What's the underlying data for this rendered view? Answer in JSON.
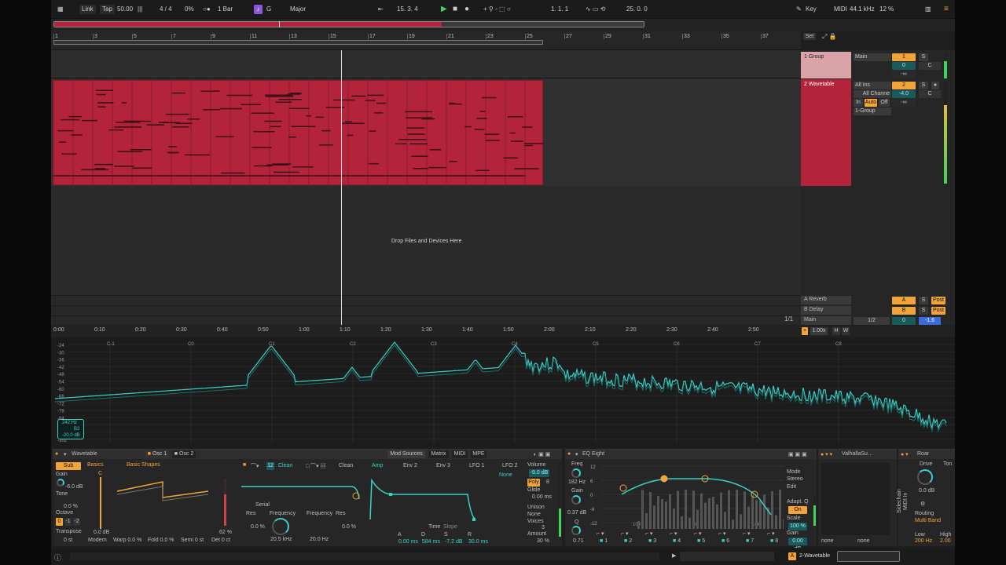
{
  "toolbar": {
    "link": "Link",
    "tap": "Tap",
    "tempo": "50.00",
    "signature": "4 / 4",
    "swing": "0%",
    "quantize": "1 Bar",
    "key": "G",
    "scale": "Major",
    "position": "15.   3.   4",
    "loop_start": "1.   1.   1",
    "loop_length": "25.   0.   0",
    "key_btn": "Key",
    "midi_btn": "MIDI",
    "sample_rate": "44.1 kHz",
    "cpu": "12 %"
  },
  "ruler": {
    "bars": [
      "1",
      "3",
      "5",
      "7",
      "9",
      "11",
      "13",
      "15",
      "17",
      "19",
      "21",
      "23",
      "25",
      "27",
      "29",
      "31",
      "33",
      "35",
      "37"
    ],
    "set_btn": "Set"
  },
  "arrangement": {
    "drop_text": "Drop Files and Devices Here",
    "fraction": "1/1"
  },
  "mixer": {
    "group_track": "1 Group",
    "group_out": "Main",
    "group_num": "1",
    "group_vol": "0",
    "group_pan": "C",
    "wt_track": "2 Wavetable",
    "wt_in": "All Ins",
    "wt_ch": "All Channe",
    "wt_out": "1-Group",
    "wt_num": "2",
    "wt_vol": "-4.0",
    "wt_pan": "C",
    "mon_in": "In",
    "mon_auto": "Auto",
    "mon_off": "Off",
    "inf": "-∞",
    "return_a": "A Reverb",
    "return_b": "B Delay",
    "master": "Main",
    "master_out": "1/2",
    "master_vol": "0",
    "master_db": "-1.6",
    "solo": "S",
    "post": "Post",
    "ret_a": "A",
    "ret_b": "B",
    "zoom": "1.00x",
    "h": "H",
    "w": "W"
  },
  "timeline": {
    "labels": [
      "0:00",
      "0:10",
      "0:20",
      "0:30",
      "0:40",
      "0:50",
      "1:00",
      "1:10",
      "1:20",
      "1:30",
      "1:40",
      "1:50",
      "2:00",
      "2:10",
      "2:20",
      "2:30",
      "2:40",
      "2:50"
    ]
  },
  "spectrum": {
    "db_labels": [
      "-24",
      "-30",
      "-36",
      "-42",
      "-48",
      "-54",
      "-60",
      "-66",
      "-72",
      "-78",
      "-84",
      "-90",
      "-96",
      "-102"
    ],
    "notes": [
      "C-1",
      "C0",
      "C1",
      "C2",
      "C3",
      "C4",
      "C5",
      "C6",
      "C7",
      "C8"
    ],
    "readout_freq": "242 Hz",
    "readout_note": "B2",
    "readout_db": "-20.0 dB"
  },
  "wavetable": {
    "title": "Wavetable",
    "osc1": "Osc 1",
    "osc2": "Osc 2",
    "sub": "Sub",
    "gain": "Gain",
    "gain_val": "-6.0 dB",
    "tone": "Tone",
    "tone_val": "0.0 %",
    "octave": "Octave",
    "oct_vals": [
      "0",
      "-1",
      "-2"
    ],
    "transpose": "Transpose",
    "transpose_val": "0 st",
    "category": "Basics",
    "table": "Basic Shapes",
    "note_c": "C",
    "gain_db": "0.0 dB",
    "pct62": "62 %",
    "mode": "Modern",
    "warp": "Warp 0.0 %",
    "fold": "Fold 0.0 %",
    "semi": "Semi 0 st",
    "det": "Det 0 ct",
    "filter1": "Clean",
    "filter2": "Clean",
    "filter_num": "12",
    "serial": "Serial",
    "res1": "Res",
    "res1_val": "0.0 %",
    "freq1": "Frequency",
    "freq1_val": "20.5 kHz",
    "freq2": "Frequency",
    "freq2_val": "20.0 Hz",
    "res2": "Res",
    "res2_val": "0.0 %",
    "mod_sources": "Mod Sources",
    "matrix": "Matrix",
    "midi": "MIDI",
    "mpe": "MPE",
    "amp": "Amp",
    "env2": "Env 2",
    "env3": "Env 3",
    "lfo1": "LFO 1",
    "lfo2": "LFO 2",
    "none": "None",
    "time": "Time",
    "slope": "Slope",
    "adsr_labels": [
      "A",
      "D",
      "S",
      "R"
    ],
    "adsr_vals": [
      "0.00 ms",
      "584 ms",
      "-7.2 dB",
      "30.0 ms"
    ],
    "volume": "Volume",
    "volume_val": "-9.0 dB",
    "poly": "Poly",
    "poly_val": "8",
    "glide": "Glide",
    "glide_val": "0.00 ms",
    "unison": "Unison",
    "unison_val": "None",
    "voices": "Voices",
    "voices_val": "3",
    "amount": "Amount",
    "amount_val": "30 %"
  },
  "eq": {
    "title": "EQ Eight",
    "freq": "Freq",
    "freq_val": "182 Hz",
    "gain": "Gain",
    "gain_val": "0.37 dB",
    "q": "Q",
    "q_val": "0.71",
    "db_marks": [
      "12",
      "6",
      "0",
      "-6",
      "-12"
    ],
    "hz_marks": [
      "100",
      "1k",
      "10k"
    ],
    "bands": [
      "1",
      "2",
      "3",
      "4",
      "5",
      "6",
      "7",
      "8"
    ],
    "mode": "Mode",
    "mode_val": "Stereo",
    "edit": "Edit",
    "adapt": "Adapt. Q",
    "adapt_val": "On",
    "scale": "Scale",
    "scale_val": "100 %",
    "out_gain": "Gain",
    "out_gain_val": "0.00 dB"
  },
  "valhalla": {
    "title": "ValhallaSu…",
    "left": "none",
    "right": "none"
  },
  "roar": {
    "title": "Roar",
    "drive": "Drive",
    "drive_val": "0.0 dB",
    "tone": "Ton",
    "routing": "Routing",
    "routing_val": "Multi Band",
    "low": "Low",
    "low_val": "200 Hz",
    "high": "High",
    "high_val": "2.00",
    "sidechain": "Sidechain",
    "midi_in": "MIDI In"
  },
  "status": {
    "track": "2-Wavetable"
  },
  "colors": {
    "accent": "#f2a33a",
    "clip": "#b3233a",
    "teal": "#3ad1c8"
  }
}
